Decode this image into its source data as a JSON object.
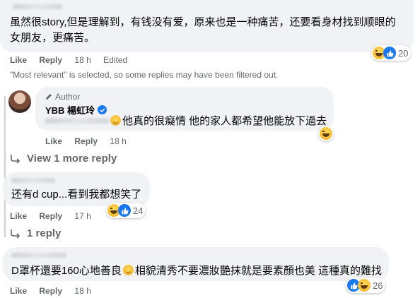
{
  "comment1": {
    "text_line1": "虽然很story,但是理解到，有钱没有爱，原来也是一种痛苦，还要看身材找到顺眼的",
    "text_line2": "女朋友，更痛苦。",
    "like": "Like",
    "reply": "Reply",
    "time": "18 h",
    "edited": "Edited",
    "reactions": [
      "haha",
      "like"
    ],
    "reaction_count": "20"
  },
  "filter_note": "\"Most relevant\" is selected, so some replies may have been filtered out.",
  "author_reply": {
    "badge": "Author",
    "name": "YBB 楊虹玲",
    "text": "他真的很癡情 他的家人都希望他能放下過去",
    "like": "Like",
    "reply": "Reply",
    "time": "18 h",
    "reactions": [
      "haha"
    ]
  },
  "view_more": "View 1 more reply",
  "comment2": {
    "text": "还有d cup...看到我都想笑了",
    "like": "Like",
    "reply": "Reply",
    "time": "17 h",
    "reactions": [
      "haha",
      "like"
    ],
    "reaction_count": "24"
  },
  "one_reply": "1 reply",
  "comment3": {
    "text_a": "D罩杯還要160心地善良",
    "text_b": "相貌清秀不要濃妝艷抹就是要素顏也美 這種真的難找",
    "like": "Like",
    "reply": "Reply",
    "time": "18 h",
    "reactions": [
      "like",
      "haha"
    ],
    "reaction_count": "26"
  },
  "colors": {
    "link": "#1877f2",
    "bubble": "#f0f2f5",
    "muted": "#65676b"
  }
}
